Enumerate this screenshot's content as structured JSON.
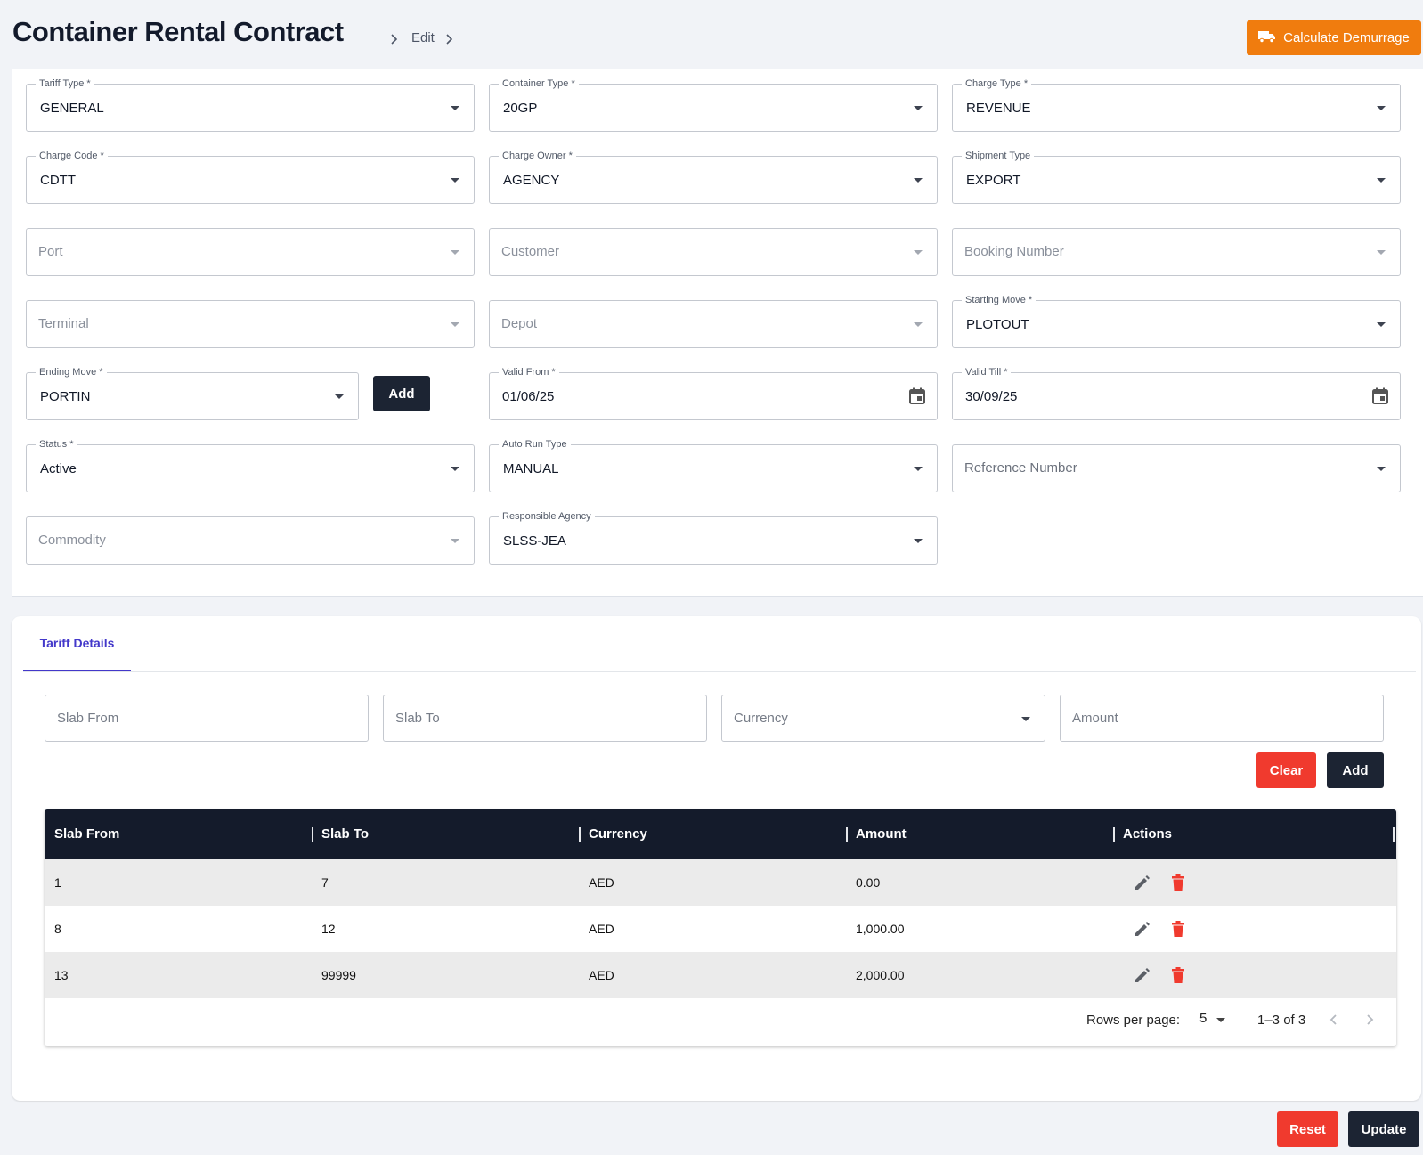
{
  "header": {
    "title": "Container Rental Contract",
    "breadcrumb_edit": "Edit",
    "calculate_label": "Calculate Demurrage"
  },
  "form": {
    "tariff_type": {
      "label": "Tariff Type *",
      "value": "GENERAL"
    },
    "container_type": {
      "label": "Container Type *",
      "value": "20GP"
    },
    "charge_type": {
      "label": "Charge Type *",
      "value": "REVENUE"
    },
    "charge_code": {
      "label": "Charge Code *",
      "value": "CDTT"
    },
    "charge_owner": {
      "label": "Charge Owner *",
      "value": "AGENCY"
    },
    "shipment_type": {
      "label": "Shipment Type",
      "value": "EXPORT"
    },
    "port": {
      "placeholder": "Port"
    },
    "customer": {
      "placeholder": "Customer"
    },
    "booking_number": {
      "placeholder": "Booking Number"
    },
    "terminal": {
      "placeholder": "Terminal"
    },
    "depot": {
      "placeholder": "Depot"
    },
    "starting_move": {
      "label": "Starting Move *",
      "value": "PLOTOUT"
    },
    "ending_move": {
      "label": "Ending Move *",
      "value": "PORTIN"
    },
    "add_label": "Add",
    "valid_from": {
      "label": "Valid From *",
      "value": "01/06/25"
    },
    "valid_till": {
      "label": "Valid Till *",
      "value": "30/09/25"
    },
    "status": {
      "label": "Status *",
      "value": "Active"
    },
    "auto_run_type": {
      "label": "Auto Run Type",
      "value": "MANUAL"
    },
    "reference_number": {
      "placeholder": "Reference Number"
    },
    "commodity": {
      "placeholder": "Commodity"
    },
    "responsible_agency": {
      "label": "Responsible Agency",
      "value": "SLSS-JEA"
    }
  },
  "tariff": {
    "tab_label": "Tariff Details",
    "slab_from_placeholder": "Slab From",
    "slab_to_placeholder": "Slab To",
    "currency_placeholder": "Currency",
    "amount_placeholder": "Amount",
    "clear_label": "Clear",
    "add_label": "Add",
    "columns": [
      "Slab From",
      "Slab To",
      "Currency",
      "Amount",
      "Actions"
    ],
    "rows": [
      {
        "slab_from": "1",
        "slab_to": "7",
        "currency": "AED",
        "amount": "0.00"
      },
      {
        "slab_from": "8",
        "slab_to": "12",
        "currency": "AED",
        "amount": "1,000.00"
      },
      {
        "slab_from": "13",
        "slab_to": "99999",
        "currency": "AED",
        "amount": "2,000.00"
      }
    ],
    "pagination": {
      "rows_per_page_label": "Rows per page:",
      "rows_per_page_value": "5",
      "range": "1–3 of 3"
    }
  },
  "footer": {
    "reset_label": "Reset",
    "update_label": "Update"
  },
  "colors": {
    "accent_orange": "#f07c0e",
    "danger_red": "#f03a2e",
    "dark_navy": "#1c2433",
    "tab_indigo": "#4338ca"
  }
}
